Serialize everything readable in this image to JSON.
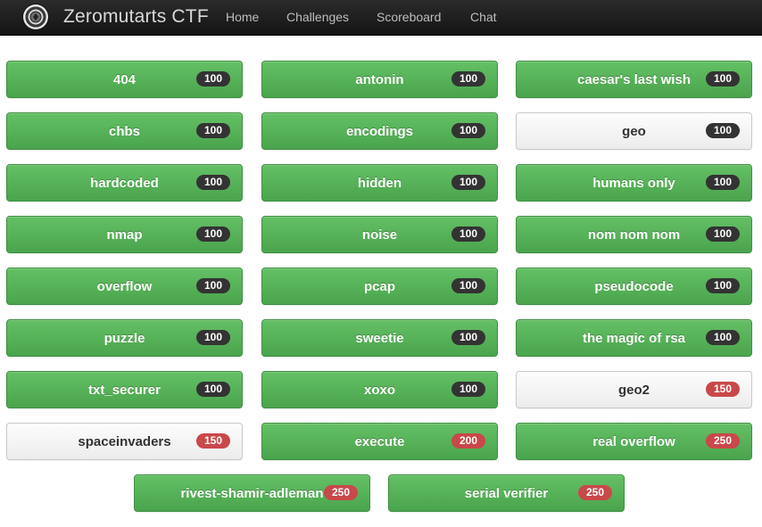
{
  "navbar": {
    "brand": "Zeromutarts CTF",
    "links": [
      "Home",
      "Challenges",
      "Scoreboard",
      "Chat"
    ]
  },
  "challenges": [
    {
      "name": "404",
      "points": "100",
      "status": "solved"
    },
    {
      "name": "antonin",
      "points": "100",
      "status": "solved"
    },
    {
      "name": "caesar's last wish",
      "points": "100",
      "status": "solved"
    },
    {
      "name": "chbs",
      "points": "100",
      "status": "solved"
    },
    {
      "name": "encodings",
      "points": "100",
      "status": "solved"
    },
    {
      "name": "geo",
      "points": "100",
      "status": "open"
    },
    {
      "name": "hardcoded",
      "points": "100",
      "status": "solved"
    },
    {
      "name": "hidden",
      "points": "100",
      "status": "solved"
    },
    {
      "name": "humans only",
      "points": "100",
      "status": "solved"
    },
    {
      "name": "nmap",
      "points": "100",
      "status": "solved"
    },
    {
      "name": "noise",
      "points": "100",
      "status": "solved"
    },
    {
      "name": "nom nom nom",
      "points": "100",
      "status": "solved"
    },
    {
      "name": "overflow",
      "points": "100",
      "status": "solved"
    },
    {
      "name": "pcap",
      "points": "100",
      "status": "solved"
    },
    {
      "name": "pseudocode",
      "points": "100",
      "status": "solved"
    },
    {
      "name": "puzzle",
      "points": "100",
      "status": "solved"
    },
    {
      "name": "sweetie",
      "points": "100",
      "status": "solved"
    },
    {
      "name": "the magic of rsa",
      "points": "100",
      "status": "solved"
    },
    {
      "name": "txt_securer",
      "points": "100",
      "status": "solved"
    },
    {
      "name": "xoxo",
      "points": "100",
      "status": "solved"
    },
    {
      "name": "geo2",
      "points": "150",
      "status": "open"
    },
    {
      "name": "spaceinvaders",
      "points": "150",
      "status": "open"
    },
    {
      "name": "execute",
      "points": "200",
      "status": "solved"
    },
    {
      "name": "real overflow",
      "points": "250",
      "status": "solved"
    },
    {
      "name": "rivest-shamir-adleman",
      "points": "250",
      "status": "solved"
    },
    {
      "name": "serial verifier",
      "points": "250",
      "status": "solved"
    }
  ],
  "colors": {
    "solved": "#5cb85c",
    "open": "#f5f5f5",
    "badge_100": "#333333",
    "badge_high": "#c9484a",
    "navbar": "#1b1b1b"
  }
}
